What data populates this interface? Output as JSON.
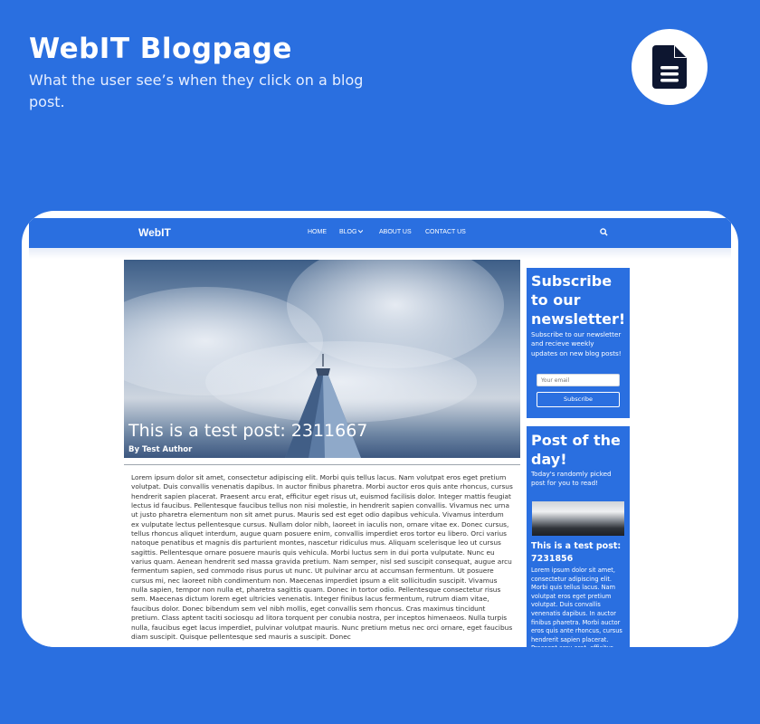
{
  "header": {
    "title": "WebIT Blogpage",
    "subtitle": "What the user see’s when they click on a blog post."
  },
  "icons": {
    "page": "document-icon",
    "search": "search-icon",
    "dropdown": "chevron-down-icon"
  },
  "colors": {
    "background": "#2a6fe0",
    "frame": "#ffffff",
    "text": "#333333"
  },
  "site": {
    "brand": "WebIT",
    "nav": [
      "HOME",
      "BLOG",
      "ABOUT US",
      "CONTACT US"
    ]
  },
  "post": {
    "title": "This is a test post: 2311667",
    "author": "By Test Author",
    "body": "Lorem ipsum dolor sit amet, consectetur adipiscing elit. Morbi quis tellus lacus. Nam volutpat eros eget pretium volutpat. Duis convallis venenatis dapibus. In auctor finibus pharetra. Morbi auctor eros quis ante rhoncus, cursus hendrerit sapien placerat. Praesent arcu erat, efficitur eget risus ut, euismod facilisis dolor. Integer mattis feugiat lectus id faucibus. Pellentesque faucibus tellus non nisi molestie, in hendrerit sapien convallis. Vivamus nec urna ut justo pharetra elementum non sit amet purus. Mauris sed est eget odio dapibus vehicula. Vivamus interdum ex vulputate lectus pellentesque cursus. Nullam dolor nibh, laoreet in iaculis non, ornare vitae ex. Donec cursus, tellus rhoncus aliquet interdum, augue quam posuere enim, convallis imperdiet eros tortor eu libero. Orci varius natoque penatibus et magnis dis parturient montes, nascetur ridiculus mus. Aliquam scelerisque leo ut cursus sagittis. Pellentesque ornare posuere mauris quis vehicula. Morbi luctus sem in dui porta vulputate. Nunc eu varius quam. Aenean hendrerit sed massa gravida pretium. Nam semper, nisl sed suscipit consequat, augue arcu fermentum sapien, sed commodo risus purus ut nunc. Ut pulvinar arcu at accumsan fermentum. Ut posuere cursus mi, nec laoreet nibh condimentum non. Maecenas imperdiet ipsum a elit sollicitudin suscipit. Vivamus nulla sapien, tempor non nulla et, pharetra sagittis quam. Donec in tortor odio. Pellentesque consectetur risus sem. Maecenas dictum lorem eget ultricies venenatis. Integer finibus lacus fermentum, rutrum diam vitae, faucibus dolor. Donec bibendum sem vel nibh mollis, eget convallis sem rhoncus. Cras maximus tincidunt pretium. Class aptent taciti sociosqu ad litora torquent per conubia nostra, per inceptos himenaeos. Nulla turpis nulla, faucibus eget lacus imperdiet, pulvinar volutpat mauris. Nunc pretium metus nec orci ornare, eget faucibus diam suscipit. Quisque pellentesque sed mauris a suscipit. Donec"
  },
  "newsletter": {
    "title": "Subscribe to our newsletter!",
    "description": "Subscribe to our newsletter and recieve weekly updates on new blog posts!",
    "email_placeholder": "Your email",
    "button": "Subscribe"
  },
  "post_of_day": {
    "title": "Post of the day!",
    "description": "Today's randomly picked post for you to read!",
    "post_title": "This is a test post: 7231856",
    "excerpt": "Lorem ipsum dolor sit amet, consectetur adipiscing elit. Morbi quis tellus lacus. Nam volutpat eros eget pretium volutpat. Duis convallis venenatis dapibus. In auctor finibus pharetra. Morbi auctor eros quis ante rhoncus, cursus hendrerit sapien placerat. Praesent arcu erat, efficitur eget risus ut"
  }
}
